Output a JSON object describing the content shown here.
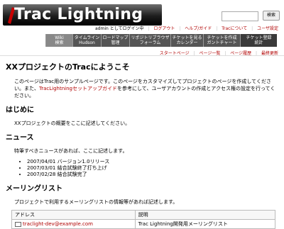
{
  "logo": {
    "text": "Trac Lightning"
  },
  "search": {
    "placeholder": "",
    "button_label": "検索"
  },
  "metanav": {
    "user_text": "admin としてログイン中",
    "items": [
      "ログアウト",
      "ヘルプ/ガイド",
      "Tracについて",
      "ユーザ設定"
    ]
  },
  "mainnav": {
    "tabs": [
      {
        "line1": "Wiki",
        "line2": "検索"
      },
      {
        "line1": "タイムライン",
        "line2": "Hudson"
      },
      {
        "line1": "ロードマップ",
        "line2": "管理"
      },
      {
        "line1": "リポジトリブラウザ",
        "line2": "フォーラム"
      },
      {
        "line1": "チケットを見る",
        "line2": "カレンダー"
      },
      {
        "line1": "チケットを作成",
        "line2": "ガントチャート"
      },
      {
        "line1": "チケット登録",
        "line2": "統計"
      }
    ]
  },
  "ctxnav": {
    "items": [
      "スタートページ",
      "ページ一覧",
      "ページ履歴",
      "最終更新"
    ]
  },
  "page": {
    "title": "XXプロジェクトのTracにようこそ",
    "intro_a": "このページはTrac用のサンプルページです。このページをカスタマイズしてプロジェクトのページを作成してください。また、",
    "intro_link": "TracLightningセットアップガイド",
    "intro_b": "を参考にして、ユーザアカウントの作成とアクセス権の設定を行ってください。",
    "sections": {
      "overview": {
        "heading": "はじめに",
        "text": "XXプロジェクトの概要をここに記述してください。"
      },
      "news": {
        "heading": "ニュース",
        "text": "特筆すべきニュースがあれば、ここに記述します。",
        "items": [
          "2007/04/01 バージョン1.0リリース",
          "2007/03/01 結合試験終了打ち上げ",
          "2007/02/28 結合試験完了"
        ]
      },
      "mailing": {
        "heading": "メーリングリスト",
        "text": "プロジェクトで利用するメーリングリストの情報等があれば記述します。",
        "table": {
          "headers": [
            "アドレス",
            "説明"
          ],
          "rows": [
            [
              "traclight-dev@example.com",
              "Trac Lightning開発用メーリングリスト"
            ]
          ]
        }
      }
    }
  },
  "colors": {
    "link": "#b00000",
    "nav_bg": "#555555",
    "nav_active": "#888888"
  }
}
